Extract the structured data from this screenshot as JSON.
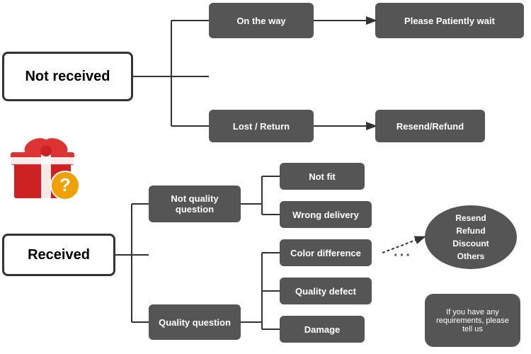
{
  "nodes": {
    "not_received": "Not received",
    "on_the_way": "On the way",
    "please_wait": "Please Patiently wait",
    "lost_return": "Lost / Return",
    "resend_refund": "Resend/Refund",
    "received": "Received",
    "not_quality_question": "Not quality question",
    "quality_question": "Quality question",
    "not_fit": "Not fit",
    "wrong_delivery": "Wrong delivery",
    "color_difference": "Color difference",
    "quality_defect": "Quality defect",
    "damage": "Damage",
    "resolutions": "Resend\nRefund\nDiscount\nOthers",
    "requirements": "If you have any requirements, please tell us"
  }
}
